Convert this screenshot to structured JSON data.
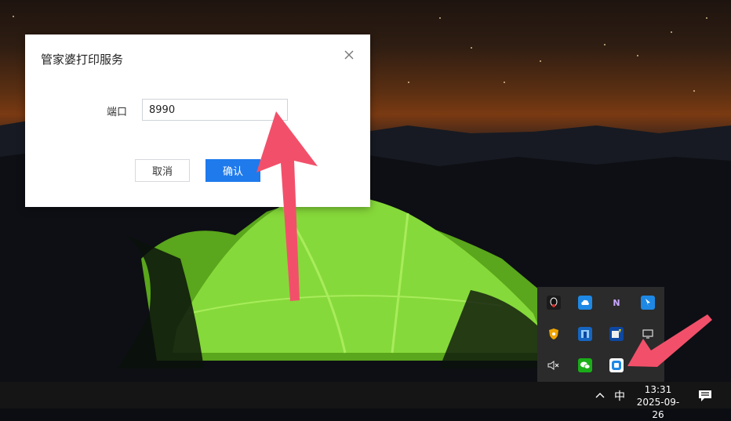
{
  "dialog": {
    "title": "管家婆打印服务",
    "port_label": "端口",
    "port_value": "8990",
    "cancel_label": "取消",
    "confirm_label": "确认"
  },
  "tray_icons": [
    {
      "name": "qq-icon",
      "color": "#1b1b1b"
    },
    {
      "name": "baidu-netdisk-icon",
      "color": "#1e88e5"
    },
    {
      "name": "onenote-tool-icon",
      "color": "#7b3fa0"
    },
    {
      "name": "feishu-icon",
      "color": "#1e88e5"
    },
    {
      "name": "security-shield-icon",
      "color": "#f0a400"
    },
    {
      "name": "bluetooth-app-icon",
      "color": "#1565c0"
    },
    {
      "name": "update-tool-icon",
      "color": "#0d47a1"
    },
    {
      "name": "network-monitor-icon",
      "color": "#555555"
    },
    {
      "name": "speaker-muted-icon",
      "color": "#2b2b2b"
    },
    {
      "name": "wechat-icon",
      "color": "#1aad19"
    },
    {
      "name": "print-service-icon",
      "color": "#1e88e5"
    }
  ],
  "taskbar": {
    "ime": "中",
    "time": "13:31",
    "date": "2025-09-26"
  },
  "colors": {
    "accent": "#1f7aec",
    "annotation_arrow": "#f2506a",
    "tent_green": "#7fd62a"
  }
}
